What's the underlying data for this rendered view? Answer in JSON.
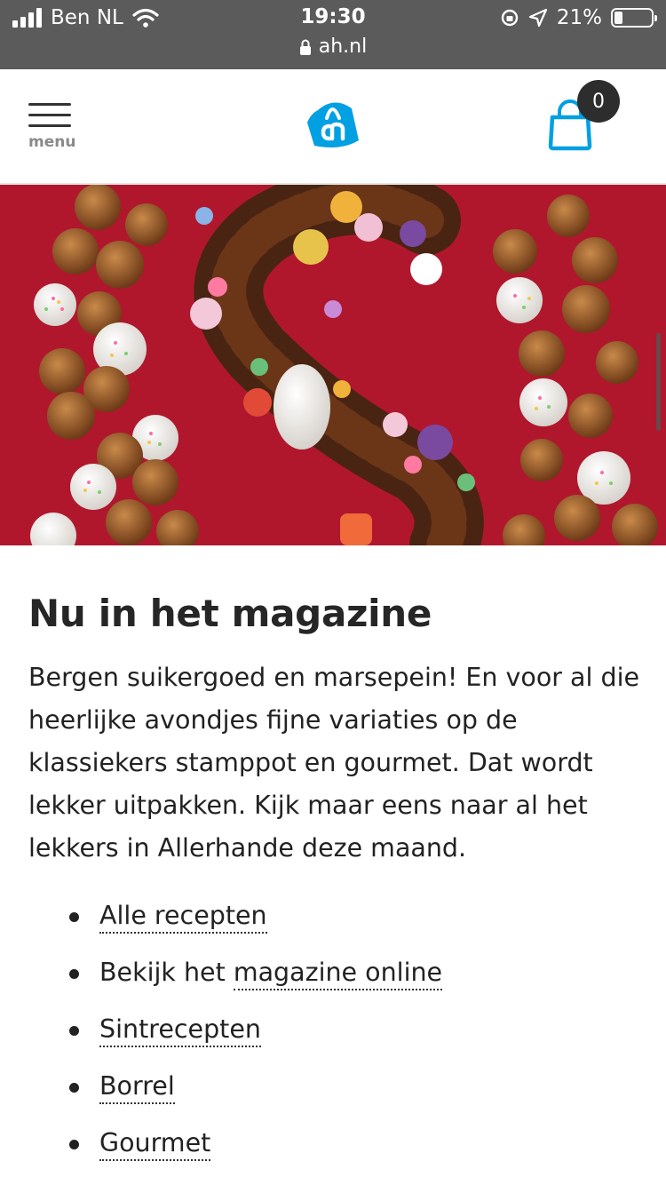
{
  "status_bar": {
    "carrier": "Ben NL",
    "time": "19:30",
    "battery": "21%",
    "url": "ah.nl"
  },
  "header": {
    "menu_label": "menu",
    "cart_count": "0",
    "brand_color": "#00a0e2"
  },
  "hero": {
    "background_color": "#b0172d"
  },
  "magazine": {
    "title": "Nu in het magazine",
    "intro": "Bergen suikergoed en marsepein! En voor al die heerlijke avondjes fijne variaties op de klassiekers stamppot en gourmet. Dat wordt lekker uitpakken. Kijk maar eens naar al het lekkers in Allerhande deze maand.",
    "links": {
      "all_recipes": "Alle recepten",
      "view_prefix": "Bekijk het",
      "magazine_online": "magazine online",
      "sint_recipes": "Sintrecepten",
      "borrel": "Borrel",
      "gourmet": "Gourmet"
    }
  }
}
